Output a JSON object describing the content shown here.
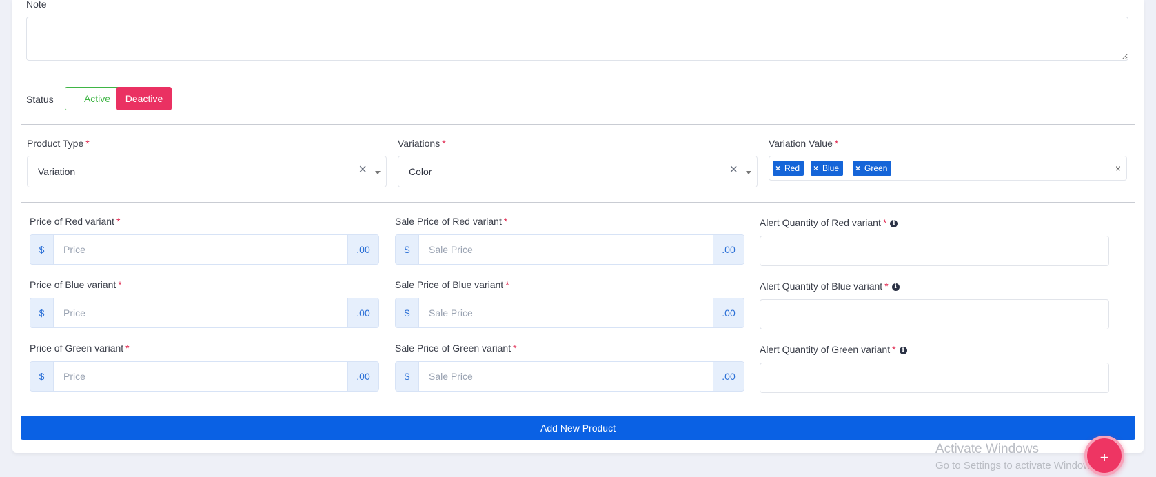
{
  "note": {
    "label": "Note",
    "value": ""
  },
  "status": {
    "label": "Status",
    "active_label": "Active",
    "deactive_label": "Deactive"
  },
  "required_mark": "*",
  "product_type": {
    "label": "Product Type",
    "value": "Variation",
    "clear_icon": "×"
  },
  "variations": {
    "label": "Variations",
    "value": "Color",
    "clear_icon": "×"
  },
  "variation_value": {
    "label": "Variation Value",
    "tags": [
      "Red",
      "Blue",
      "Green"
    ],
    "tag_remove_icon": "×",
    "clear_all_icon": "×"
  },
  "variants": [
    {
      "price_label": "Price of Red variant",
      "sale_label": "Sale Price of Red variant",
      "alert_label": "Alert Quantity of Red variant"
    },
    {
      "price_label": "Price of Blue variant",
      "sale_label": "Sale Price of Blue variant",
      "alert_label": "Alert Quantity of Blue variant"
    },
    {
      "price_label": "Price of Green variant",
      "sale_label": "Sale Price of Green variant",
      "alert_label": "Alert Quantity of Green variant"
    }
  ],
  "inputs": {
    "currency_prefix": "$",
    "decimal_suffix": ".00",
    "price_placeholder": "Price",
    "sale_placeholder": "Sale Price",
    "info_icon": "i"
  },
  "submit_label": "Add New Product",
  "watermark": {
    "line1": "Activate Windows",
    "line2": "Go to Settings to activate Windows."
  },
  "fab_icon": "+",
  "colors": {
    "primary": "#0a61e4",
    "danger": "#ea3162",
    "success": "#3fb545",
    "fab": "#ee3563"
  }
}
